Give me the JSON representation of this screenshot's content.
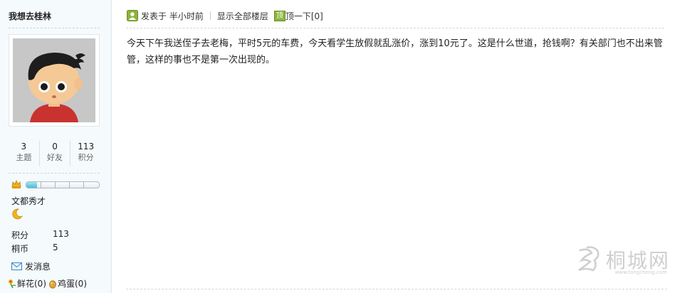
{
  "profile": {
    "username": "我想去桂林",
    "stats": [
      {
        "value": "3",
        "label": "主题"
      },
      {
        "value": "0",
        "label": "好友"
      },
      {
        "value": "113",
        "label": "积分"
      }
    ],
    "level_progress": 0.15,
    "rank": "文都秀才",
    "details": [
      {
        "key": "积分",
        "value": "113"
      },
      {
        "key": "桐币",
        "value": "5"
      }
    ],
    "send_message": "发消息",
    "flowers": "鲜花(0)",
    "eggs": "鸡蛋(0)"
  },
  "post": {
    "posted": "发表于  半小时前",
    "show_all": "显示全部楼层",
    "top_badge": "顶",
    "top_action": "顶一下[0]",
    "content": "今天下午我送侄子去老梅，平时5元的车费，今天看学生放假就乱涨价，涨到10元了。这是什么世道，抢钱啊？有关部门也不出来管管，这样的事也不是第一次出现的。"
  },
  "watermark": {
    "text": "桐城网",
    "url": "www.tongcheng.com"
  },
  "colors": {
    "sidebar_bg": "#f5fafc",
    "badge_green": "#8cb43c"
  }
}
